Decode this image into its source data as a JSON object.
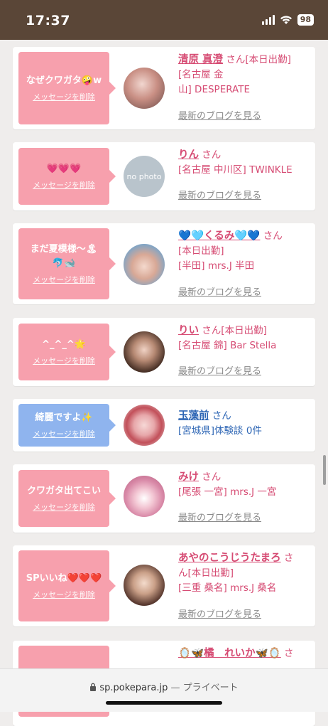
{
  "status": {
    "time": "17:37",
    "battery": "98"
  },
  "messages": [
    {
      "bubble": "なぜクワガタ🤪w",
      "delete": "メッセージを削除",
      "name": "清原 真澄",
      "san": "さん",
      "lines": [
        "[本日出勤]",
        "[名古屋 金",
        "山] DESPERATE"
      ],
      "blog": "最新のブログを見る"
    },
    {
      "bubble": "💗💗💗",
      "delete": "メッセージを削除",
      "name": "りん",
      "san": "さん",
      "lines": [
        "[名古屋 中川区] TWINKLE"
      ],
      "avatar_text": "no photo",
      "blog": "最新のブログを見る"
    },
    {
      "bubble": "まだ夏模様〜🏝\n🐬🐋",
      "delete": "メッセージを削除",
      "name": "💙🩵くるみ🩵💙",
      "san": "さん",
      "lines": [
        "[本日出勤]",
        "[半田] mrs.J 半田"
      ],
      "blog": "最新のブログを見る"
    },
    {
      "bubble": "^_^_^🌟",
      "delete": "メッセージを削除",
      "name": "りい",
      "san": "さん[本日出勤]",
      "lines": [
        "[名古屋 錦] Bar Stella"
      ],
      "blog": "最新のブログを見る"
    },
    {
      "bubble": "綺麗ですよ✨",
      "delete": "メッセージを削除",
      "name": "玉藻前",
      "san": "さん",
      "lines": [
        "[宮城県]体験談 0件"
      ],
      "blog": ""
    },
    {
      "bubble": "クワガタ出てこい",
      "delete": "メッセージを削除",
      "name": "みけ",
      "san": "さん",
      "lines": [
        "[尾張 一宮] mrs.J 一宮"
      ],
      "blog": "最新のブログを見る"
    },
    {
      "bubble": "SPいいね❤️❤️❤️",
      "delete": "メッセージを削除",
      "name": "あやのこうじうたまろ",
      "san": "さ",
      "lines": [
        "ん[本日出勤]",
        "[三重 桑名] mrs.J 桑名"
      ],
      "blog": "最新のブログを見る"
    },
    {
      "bubble": "❤️",
      "delete": "",
      "name": "🪞🦋橘　れいか🦋🪞",
      "san": "さ",
      "lines": [],
      "blog": ""
    }
  ],
  "browser": {
    "domain": "sp.pokepara.jp",
    "separator": " — ",
    "mode": "プライベート"
  },
  "colors": {
    "bubble_pink": "#f7a0ad",
    "bubble_blue": "#8fb4ee",
    "name_pink": "#d64b73",
    "name_blue": "#2f67b5",
    "status_bar": "#5a4637"
  }
}
